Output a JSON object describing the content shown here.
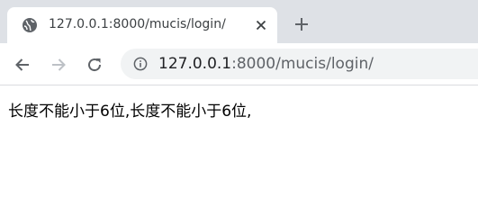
{
  "tab": {
    "title": "127.0.0.1:8000/mucis/login/",
    "favicon": "globe-icon",
    "close": "close-icon",
    "new_tab": "plus-icon"
  },
  "toolbar": {
    "back": "back-arrow-icon",
    "forward": "forward-arrow-icon",
    "reload": "reload-icon",
    "site_info": "info-icon",
    "url_host": "127.0.0.1",
    "url_path": ":8000/mucis/login/"
  },
  "colors": {
    "tabstrip_bg": "#dee1e6",
    "omnibox_bg": "#f1f3f4",
    "icon_color": "#5f6368",
    "disabled_icon": "#bdc1c6"
  },
  "content": {
    "message": "长度不能小于6位,长度不能小于6位,"
  }
}
